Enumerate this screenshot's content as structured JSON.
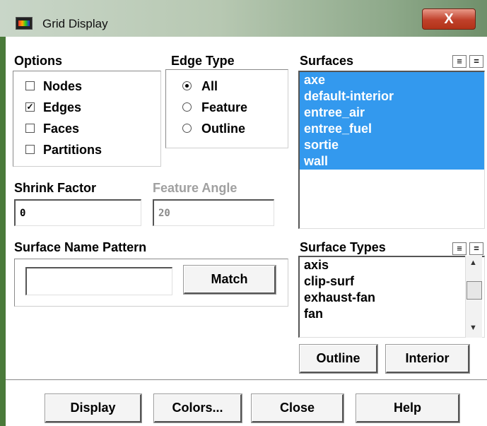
{
  "window": {
    "title": "Grid Display",
    "close_glyph": "X",
    "icon": "fluent-app-icon"
  },
  "options": {
    "heading": "Options",
    "items": [
      {
        "label": "Nodes",
        "checked": false,
        "mark": ""
      },
      {
        "label": "Edges",
        "checked": true,
        "mark": "✓"
      },
      {
        "label": "Faces",
        "checked": false,
        "mark": ""
      },
      {
        "label": "Partitions",
        "checked": false,
        "mark": ""
      }
    ]
  },
  "edge_type": {
    "heading": "Edge Type",
    "items": [
      {
        "label": "All",
        "selected": true
      },
      {
        "label": "Feature",
        "selected": false
      },
      {
        "label": "Outline",
        "selected": false
      }
    ]
  },
  "shrink_factor": {
    "label": "Shrink Factor",
    "value": "0"
  },
  "feature_angle": {
    "label": "Feature Angle",
    "value": "20"
  },
  "surface_name_pattern": {
    "label": "Surface Name Pattern",
    "value": "",
    "match_label": "Match"
  },
  "surfaces": {
    "heading": "Surfaces",
    "items": [
      "axe",
      "default-interior",
      "entree_air",
      "entree_fuel",
      "sortie",
      "wall"
    ],
    "all_selected": true
  },
  "surface_types": {
    "heading": "Surface Types",
    "items": [
      "axis",
      "clip-surf",
      "exhaust-fan",
      "fan"
    ],
    "outline_label": "Outline",
    "interior_label": "Interior"
  },
  "footer": {
    "display_label": "Display",
    "colors_label": "Colors...",
    "close_label": "Close",
    "help_label": "Help"
  },
  "colors": {
    "selection": "#3399ee",
    "close_button": "#c0402a"
  }
}
